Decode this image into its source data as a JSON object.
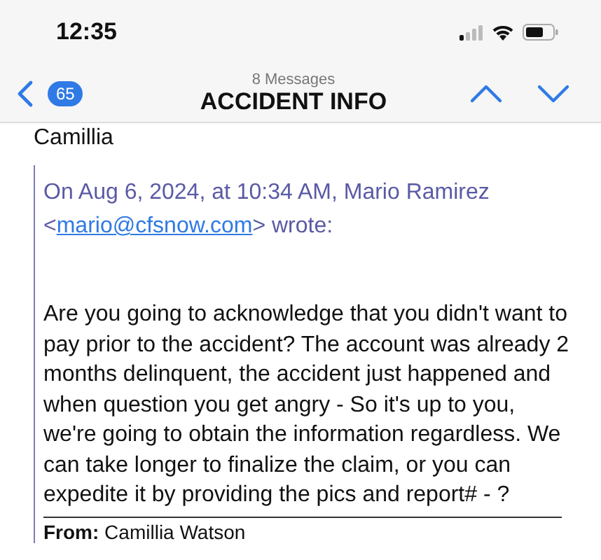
{
  "status_bar": {
    "time": "12:35"
  },
  "nav": {
    "unread_count": "65",
    "subtitle": "8 Messages",
    "title": "ACCIDENT INFO"
  },
  "message": {
    "signature": "Camillia",
    "quote": {
      "header_prefix": "On Aug 6, 2024, at 10:34 AM, Mario Ramirez",
      "header_open": "<",
      "email": "mario@cfsnow.com",
      "header_suffix": "> wrote:",
      "body": "Are you going to acknowledge that you didn't want to pay prior to the accident? The account was already 2 months delinquent, the accident just happened and when question you get angry - So it's up to you, we're going to obtain the information regardless. We can take longer to finalize the claim, or you can expedite it by providing the pics and report# - ?",
      "from_label": "From:",
      "from_name": "Camillia Watson"
    }
  }
}
